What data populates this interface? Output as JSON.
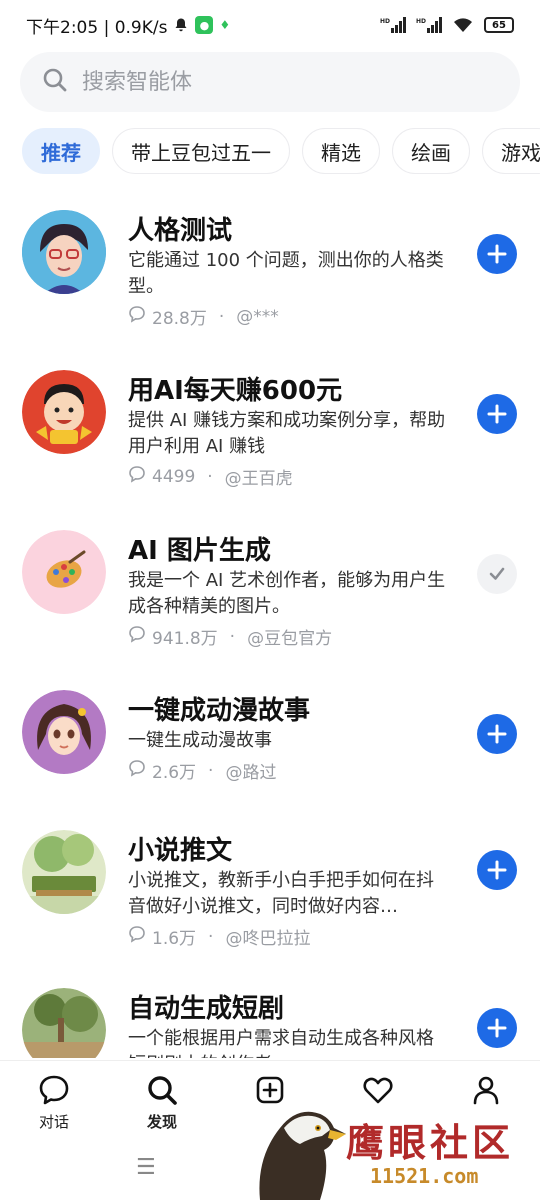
{
  "status_bar": {
    "time_speed": "下午2:05 | 0.9K/s",
    "battery": "65"
  },
  "search": {
    "placeholder": "搜索智能体"
  },
  "tabs": [
    {
      "label": "推荐",
      "active": true
    },
    {
      "label": "带上豆包过五一",
      "active": false
    },
    {
      "label": "精选",
      "active": false
    },
    {
      "label": "绘画",
      "active": false
    },
    {
      "label": "游戏",
      "active": false
    }
  ],
  "agents": [
    {
      "title": "人格测试",
      "desc": "它能通过 100 个问题，测出你的人格类型。",
      "count": "28.8万",
      "author": "@***",
      "added": false
    },
    {
      "title": "用AI每天赚600元",
      "desc": "提供 AI 赚钱方案和成功案例分享，帮助用户利用 AI 赚钱",
      "count": "4499",
      "author": "@王百虎",
      "added": false
    },
    {
      "title": "AI 图片生成",
      "desc": "我是一个 AI 艺术创作者，能够为用户生成各种精美的图片。",
      "count": "941.8万",
      "author": "@豆包官方",
      "added": true
    },
    {
      "title": "一键成动漫故事",
      "desc": "一键生成动漫故事",
      "count": "2.6万",
      "author": "@路过",
      "added": false
    },
    {
      "title": "小说推文",
      "desc": "小说推文，教新手小白手把手如何在抖音做好小说推文，同时做好内容…",
      "count": "1.6万",
      "author": "@咚巴拉拉",
      "added": false
    },
    {
      "title": "自动生成短剧",
      "desc": "一个能根据用户需求自动生成各种风格短剧剧本的创作者",
      "count": "",
      "author": "",
      "added": false
    }
  ],
  "meta_separator": "·",
  "nav": {
    "chat": "对话",
    "discover": "发现",
    "create": "",
    "favorites": "",
    "profile": ""
  },
  "watermark": {
    "title": "鹰眼社区",
    "url": "11521.com"
  },
  "colors": {
    "accent": "#1e6ae6",
    "tab_active_bg": "#e5effd"
  }
}
